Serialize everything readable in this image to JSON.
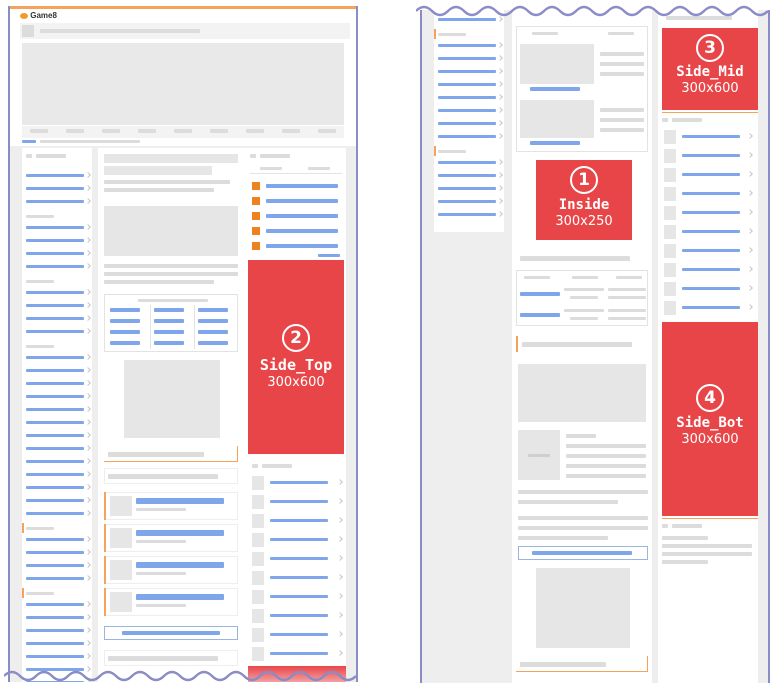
{
  "ads": [
    {
      "id": "inside",
      "number": "1",
      "name": "Inside",
      "size": "300x250"
    },
    {
      "id": "side_top",
      "number": "2",
      "name": "Side_Top",
      "size": "300x600"
    },
    {
      "id": "side_mid",
      "number": "3",
      "name": "Side_Mid",
      "size": "300x600"
    },
    {
      "id": "side_bot",
      "number": "4",
      "name": "Side_Bot",
      "size": "300x600"
    }
  ],
  "logo_text": "Game8",
  "colors": {
    "ad_red": "#e84549",
    "accent_orange": "#f5a25b",
    "frame_purple": "#8a8cc4",
    "placeholder_blue": "#7fa6ea",
    "placeholder_grey": "#dcdcdc"
  }
}
